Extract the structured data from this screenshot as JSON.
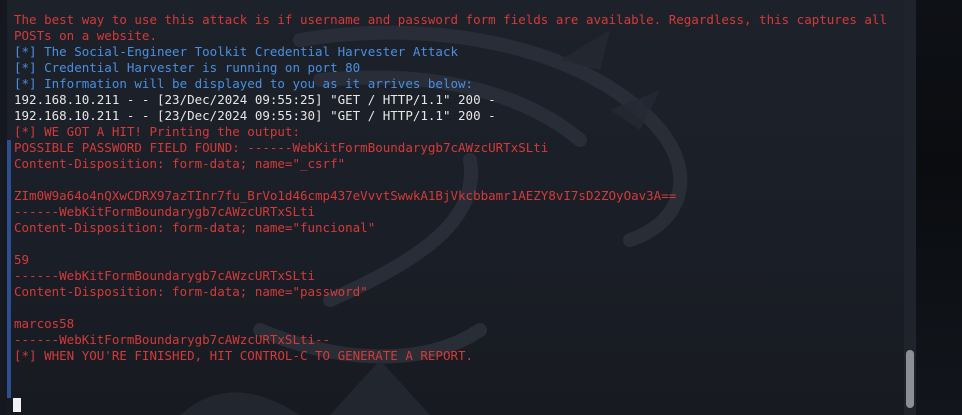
{
  "terminal": {
    "lines": [
      {
        "text": "The best way to use this attack is if username and password form fields are available. Regardless, this captures all POSTs on a website.",
        "color": "#d43a3a"
      },
      {
        "text": "[*] The Social-Engineer Toolkit Credential Harvester Attack",
        "color": "#4a8fe0"
      },
      {
        "text": "[*] Credential Harvester is running on port 80",
        "color": "#4a8fe0"
      },
      {
        "text": "[*] Information will be displayed to you as it arrives below:",
        "color": "#4a8fe0"
      },
      {
        "text": "192.168.10.211 - - [23/Dec/2024 09:55:25] \"GET / HTTP/1.1\" 200 -",
        "color": "#e6e6e6"
      },
      {
        "text": "192.168.10.211 - - [23/Dec/2024 09:55:30] \"GET / HTTP/1.1\" 200 -",
        "color": "#e6e6e6"
      },
      {
        "text": "[*] WE GOT A HIT! Printing the output:",
        "color": "#d43a3a"
      },
      {
        "text": "POSSIBLE PASSWORD FIELD FOUND: ------WebKitFormBoundarygb7cAWzcURTxSLti",
        "color": "#d43a3a"
      },
      {
        "text": "Content-Disposition: form-data; name=\"_csrf\"",
        "color": "#d43a3a"
      },
      {
        "text": "",
        "color": "#d43a3a"
      },
      {
        "text": "ZIm0W9a64o4nQXwCDRX97azTInr7fu_BrVo1d46cmp437eVvvtSwwkA1BjVkcbbamr1AEZY8vI7sD2ZOyOav3A==",
        "color": "#d43a3a"
      },
      {
        "text": "------WebKitFormBoundarygb7cAWzcURTxSLti",
        "color": "#d43a3a"
      },
      {
        "text": "Content-Disposition: form-data; name=\"funcional\"",
        "color": "#d43a3a"
      },
      {
        "text": "",
        "color": "#d43a3a"
      },
      {
        "text": "59",
        "color": "#d43a3a"
      },
      {
        "text": "------WebKitFormBoundarygb7cAWzcURTxSLti",
        "color": "#d43a3a"
      },
      {
        "text": "Content-Disposition: form-data; name=\"password\"",
        "color": "#d43a3a"
      },
      {
        "text": "",
        "color": "#d43a3a"
      },
      {
        "text": "marcos58",
        "color": "#d43a3a"
      },
      {
        "text": "------WebKitFormBoundarygb7cAWzcURTxSLti--",
        "color": "#d43a3a"
      },
      {
        "text": "[*] WHEN YOU'RE FINISHED, HIT CONTROL-C TO GENERATE A REPORT.",
        "color": "#d43a3a"
      }
    ]
  },
  "colors": {
    "background": "#1b1f27",
    "error_red": "#d43a3a",
    "info_blue": "#4a8fe0",
    "log_white": "#e6e6e6",
    "scroll_thumb": "#8c8f96"
  },
  "icons": {
    "wallpaper": "kali-dragon-watermark-icon",
    "cursor": "block-cursor-icon"
  }
}
